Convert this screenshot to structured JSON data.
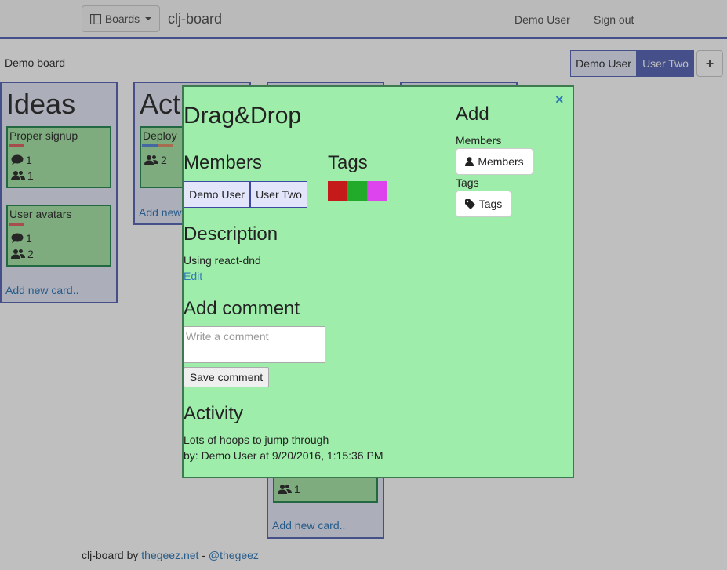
{
  "navbar": {
    "boards_label": "Boards",
    "boards_icon": "columns-icon",
    "brand": "clj-board",
    "user": "Demo User",
    "sign_out": "Sign out"
  },
  "board": {
    "title": "Demo board",
    "members": [
      "Demo User",
      "User Two"
    ],
    "add_member": "+"
  },
  "lists": [
    {
      "title": "Ideas",
      "cards": [
        {
          "title": "Proper signup",
          "labels": [
            "#e06666"
          ],
          "comments": "1",
          "members": "1"
        },
        {
          "title": "User avatars",
          "labels": [
            "#e06666"
          ],
          "comments": "1",
          "members": "2"
        }
      ],
      "add_card": "Add new card.."
    },
    {
      "title": "Act",
      "cards": [
        {
          "title": "Deploy",
          "labels": [
            "#5b8bd8",
            "#e0916b"
          ],
          "members": "2"
        }
      ],
      "add_card": "Add new"
    },
    {
      "title": "",
      "cards": [
        {
          "title": "",
          "members": "1"
        }
      ],
      "add_card": "Add new card.."
    }
  ],
  "footer": {
    "prefix": "clj-board by",
    "site": "thegeez.net",
    "separator": "-",
    "twitter": "@thegeez"
  },
  "modal": {
    "title": "Drag&Drop",
    "close": "×",
    "members_heading": "Members",
    "members": [
      "Demo User",
      "User Two"
    ],
    "tags_heading": "Tags",
    "tags": [
      "#c41a1a",
      "#22aa2a",
      "#dd44ee"
    ],
    "description_heading": "Description",
    "description": "Using react-dnd",
    "edit_label": "Edit",
    "add_comment_heading": "Add comment",
    "comment_placeholder": "Write a comment",
    "save_comment": "Save comment",
    "activity_heading": "Activity",
    "activity": [
      {
        "text": "Lots of hoops to jump through",
        "meta": "by: Demo User at 9/20/2016, 1:15:36 PM"
      }
    ],
    "add_heading": "Add",
    "add_members_label": "Members",
    "add_members_button": "Members",
    "add_tags_label": "Tags",
    "add_tags_button": "Tags"
  }
}
